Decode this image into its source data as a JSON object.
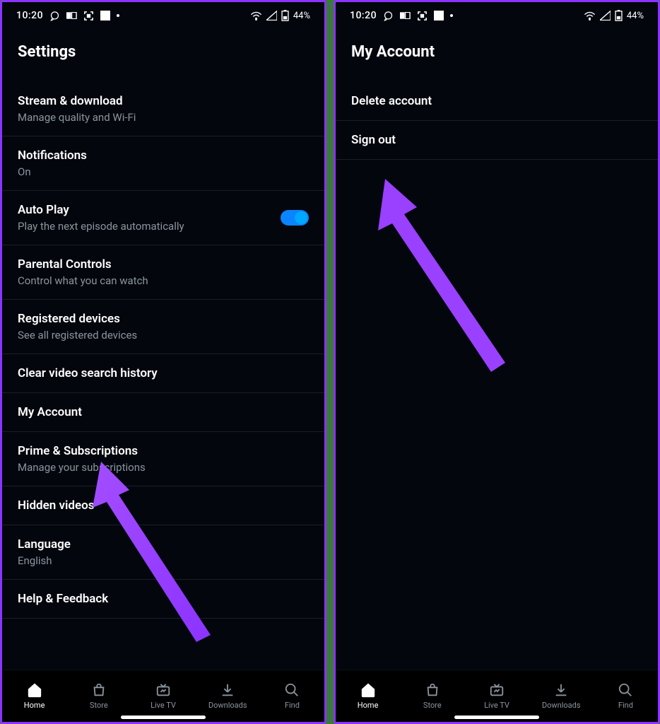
{
  "status": {
    "time": "10:20",
    "battery": "44%"
  },
  "left": {
    "title": "Settings",
    "items": [
      {
        "title": "Stream & download",
        "sub": "Manage quality and Wi-Fi"
      },
      {
        "title": "Notifications",
        "sub": "On"
      },
      {
        "title": "Auto Play",
        "sub": "Play the next episode automatically",
        "toggle": true
      },
      {
        "title": "Parental Controls",
        "sub": "Control what you can watch"
      },
      {
        "title": "Registered devices",
        "sub": "See all registered devices"
      },
      {
        "title": "Clear video search history"
      },
      {
        "title": "My Account"
      },
      {
        "title": "Prime & Subscriptions",
        "sub": "Manage your subscriptions"
      },
      {
        "title": "Hidden videos"
      },
      {
        "title": "Language",
        "sub": "English"
      },
      {
        "title": "Help & Feedback"
      }
    ]
  },
  "right": {
    "title": "My Account",
    "items": [
      {
        "title": "Delete account"
      },
      {
        "title": "Sign out"
      }
    ]
  },
  "nav": {
    "items": [
      {
        "label": "Home",
        "active": true
      },
      {
        "label": "Store"
      },
      {
        "label": "Live TV"
      },
      {
        "label": "Downloads"
      },
      {
        "label": "Find"
      }
    ]
  }
}
